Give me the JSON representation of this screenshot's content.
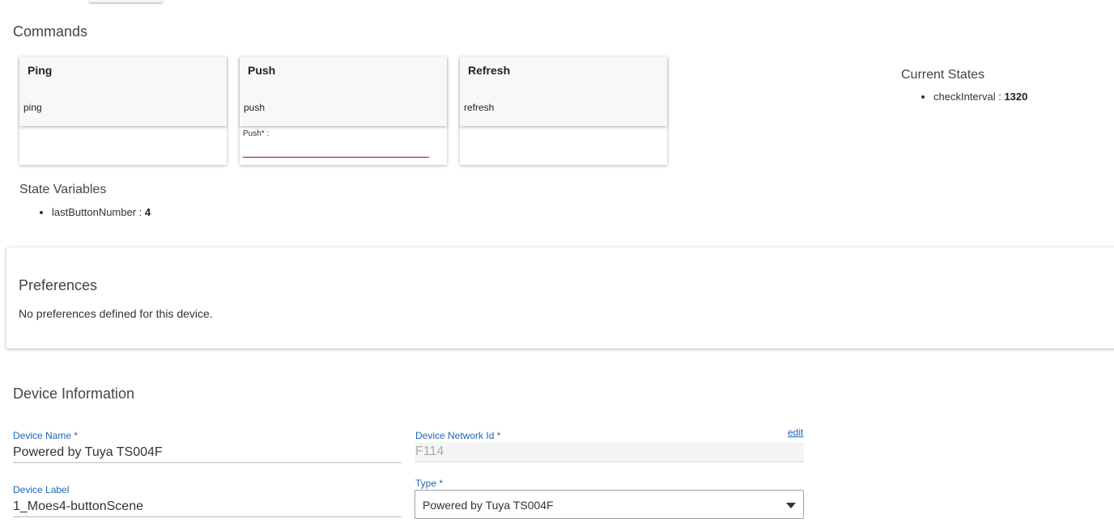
{
  "commands": {
    "title": "Commands",
    "cards": [
      {
        "title": "Ping",
        "method": "ping"
      },
      {
        "title": "Push",
        "method": "push",
        "param_label": "Push* :",
        "param_value": ""
      },
      {
        "title": "Refresh",
        "method": "refresh"
      }
    ]
  },
  "current_states": {
    "title": "Current States",
    "items": [
      {
        "key": "checkInterval",
        "value": "1320"
      }
    ]
  },
  "state_variables": {
    "title": "State Variables",
    "items": [
      {
        "key": "lastButtonNumber",
        "value": "4"
      }
    ]
  },
  "preferences": {
    "title": "Preferences",
    "empty_text": "No preferences defined for this device."
  },
  "device_info": {
    "title": "Device Information",
    "name_label": "Device Name *",
    "name_value": "Powered by Tuya TS004F",
    "network_id_label": "Device Network Id *",
    "network_id_value": "F114",
    "edit_label": "edit",
    "label_label": "Device Label",
    "label_value": "1_Moes4-buttonScene",
    "type_label": "Type *",
    "type_value": "Powered by Tuya TS004F"
  },
  "colors": {
    "accent": "#1e66b5",
    "error_underline": "#8b1a1a"
  }
}
